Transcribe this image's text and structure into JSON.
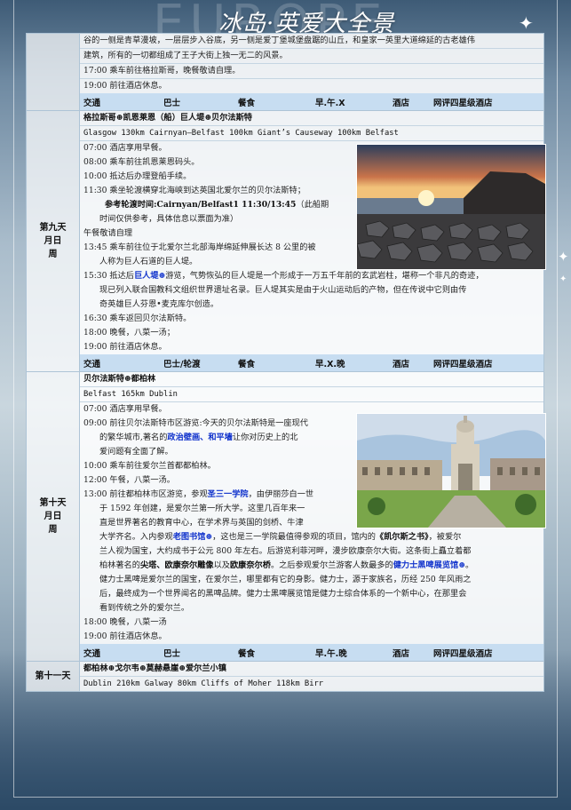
{
  "header": {
    "title": "冰岛·英爱大全景",
    "bg_word": "EUROPE"
  },
  "colors": {
    "info_bar": "#c7ddf1",
    "highlight": "#1133cc",
    "grid": "#aec4d6"
  },
  "top_block": {
    "lines": [
      "谷的一侧是青草漫坡，一层层步入谷底，另一侧是爱丁堡城堡盘踞的山丘，和皇家一英里大道绵延的古老雄伟",
      "建筑，所有的一切都组成了王子大街上独一无二的风景。",
      "17:00 乘车前往格拉斯哥，晚餐敬请自理。",
      "19:00 前往酒店休息。"
    ],
    "info": {
      "transport_label": "交通",
      "transport": "巴士",
      "meal_label": "餐食",
      "meals": "早.午.X",
      "hotel_label": "酒店",
      "hotel": "网评四星级酒店"
    }
  },
  "day9": {
    "day": [
      "第九天",
      "月日",
      "周"
    ],
    "route": "格拉斯哥⊕凯恩莱恩（船）巨人堤⊕贝尔法斯特",
    "distance": "Glasgow 130km Cairnyan—Belfast 100km Giant’s Causeway 100km Belfast",
    "l1": "07:00 酒店享用早餐。",
    "l2": "08:00 乘车前往凯恩莱恩码头。",
    "l3": "10:00 抵达后办理登船手续。",
    "l4": "11:30 乘坐轮渡横穿北海峡到达英国北爱尔兰的贝尔法斯特；",
    "ferry_label": "参考轮渡时间:Cairnyan/Belfast1 11:30/13:45",
    "ferry_note": "（此船期",
    "ferry_note2": "时间仅供参考，具体信息以票面为准）",
    "l5": "午餐敬请自理",
    "l6a": "13:45 乘车前往位于北爱尔兰北部海岸绵延伸展长达 8 公里的被",
    "l6b": "人称为巨人石道的巨人堤。",
    "l7_pre": "15:30 抵达后",
    "l7_hl": "巨人堤⊕",
    "l7_post": "游览，气势恢弘的巨人堤是一个形成于一万五千年前的玄武岩柱，堪称一个非凡的奇迹，",
    "l7b": "现已列入联合国教科文组织世界遗址名录。巨人堤其实是由于火山运动后的产物，但在传说中它则由传",
    "l7c": "奇英雄巨人芬恩•麦克库尔创造。",
    "l8": "16:30 乘车返回贝尔法斯特。",
    "l9": "18:00 晚餐，八菜一汤；",
    "l10": "19:00 前往酒店休息。",
    "info": {
      "transport_label": "交通",
      "transport": "巴士/轮渡",
      "meal_label": "餐食",
      "meals": "早.X.晚",
      "hotel_label": "酒店",
      "hotel": "网评四星级酒店"
    }
  },
  "day10": {
    "day": [
      "第十天",
      "月日",
      "周"
    ],
    "route": "贝尔法斯特⊕都柏林",
    "distance": "Belfast 165km Dublin",
    "l1": "07:00 酒店享用早餐。",
    "l2a": "09:00 前往贝尔法斯特市区游览:今天的贝尔法斯特是一座现代",
    "l2b_pre": "的繁华城市,著名的",
    "l2b_hl": "政治壁画、和平墙",
    "l2b_post": "让你对历史上的北",
    "l2c": "爱问题有全面了解。",
    "l3": "10:00 乘车前往爱尔兰首都都柏林。",
    "l4": "12:00 午餐，八菜一汤。",
    "l5a_pre": "13:00 前往都柏林市区游览，参观",
    "l5a_hl": "圣三一学院",
    "l5a_post": "，由伊丽莎白一世",
    "l5b": "于 1592 年创建，是爱尔兰第一所大学。这里几百年来一",
    "l5c": "直是世界著名的教育中心，在学术界与英国的剑桥、牛津",
    "l5d_pre": "大学齐名。入内参观",
    "l5d_hl": "老图书馆⊕",
    "l5d_mid": "，这也是三一学院最值得参观的项目，馆内的",
    "l5d_bk": "《凯尔斯之书》",
    "l5d_post": "，被爱尔",
    "l5e": "兰人视为国宝，大约成书于公元 800 年左右。后游览利菲河畔，漫步欧康奈尔大街。这条街上矗立着都",
    "l5f_pre": "柏林著名的",
    "l5f_bk1": "尖塔、欧康奈尔雕像",
    "l5f_mid": "以及",
    "l5f_bk2": "欧康奈尔桥",
    "l5f_mid2": "。之后参观爱尔兰游客人数最多的",
    "l5f_hl": "健力士黑啤展览馆⊕",
    "l5f_post": "。",
    "l5g": "健力士黑啤是爱尔兰的国宝，在爱尔兰，哪里都有它的身影。健力士，源于家族名，历经 250 年风雨之",
    "l5h": "后，最终成为一个世界闻名的黑啤品牌。健力士黑啤展览馆是健力士综合体系的一个新中心，在那里会",
    "l5i": "看到传统之外的爱尔兰。",
    "l6": "18:00 晚餐，八菜一汤",
    "l7": "19:00 前往酒店休息。",
    "info": {
      "transport_label": "交通",
      "transport": "巴士",
      "meal_label": "餐食",
      "meals": "早.午.晚",
      "hotel_label": "酒店",
      "hotel": "网评四星级酒店"
    }
  },
  "day11": {
    "day": [
      "第十一天"
    ],
    "route": "都柏林⊕戈尔韦⊕莫赫悬崖⊕爱尔兰小镇",
    "distance": "Dublin 210km Galway 80km Cliffs of Moher 118km  Birr"
  }
}
